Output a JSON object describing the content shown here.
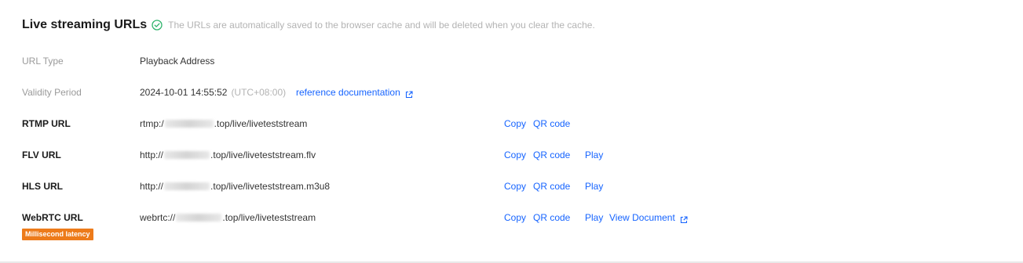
{
  "section": {
    "title": "Live streaming URLs",
    "hint": "The URLs are automatically saved to the browser cache and will be deleted when you clear the cache."
  },
  "url_type": {
    "label": "URL Type",
    "value": "Playback Address"
  },
  "validity": {
    "label": "Validity Period",
    "datetime": "2024-10-01 14:55:52",
    "timezone": "(UTC+08:00)",
    "ref_link": "reference documentation"
  },
  "urls": [
    {
      "label": "RTMP URL",
      "prefix": "rtmp:/",
      "suffix": ".top/live/liveteststream"
    },
    {
      "label": "FLV URL",
      "prefix": "http://",
      "suffix": ".top/live/liveteststream.flv"
    },
    {
      "label": "HLS URL",
      "prefix": "http://",
      "suffix": ".top/live/liveteststream.m3u8"
    },
    {
      "label": "WebRTC URL",
      "prefix": "webrtc://",
      "suffix": ".top/live/liveteststream"
    }
  ],
  "actions": {
    "copy": "Copy",
    "qr": "QR code",
    "play": "Play",
    "doc": "View Document"
  },
  "badge": "Millisecond latency",
  "colors": {
    "link": "#1664ff",
    "success": "#2fb36b",
    "badge": "#ed7b1a"
  }
}
